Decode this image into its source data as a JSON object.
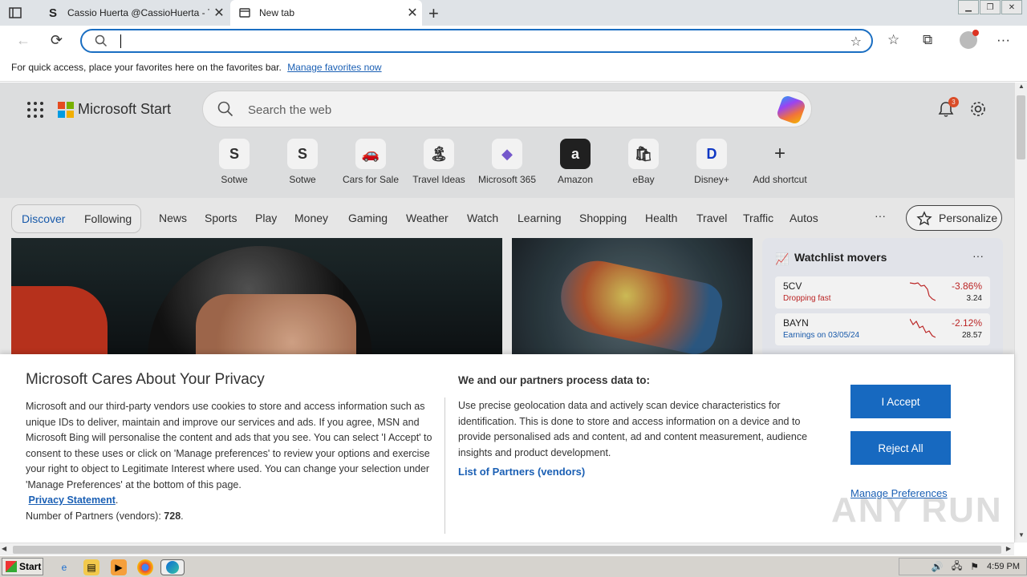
{
  "browser": {
    "tabs": [
      {
        "title": "Cassio Huerta @CassioHuerta - T",
        "favicon": "S",
        "active": false
      },
      {
        "title": "New tab",
        "favicon": "newtab-icon",
        "active": true
      }
    ],
    "favbar_text": "For quick access, place your favorites here on the favorites bar.",
    "favbar_link": "Manage favorites now"
  },
  "msstart": {
    "brand": "Microsoft Start",
    "search_placeholder": "Search the web",
    "notif_count": "3",
    "shortcuts": [
      {
        "label": "Sotwe",
        "glyph": "S"
      },
      {
        "label": "Sotwe",
        "glyph": "S"
      },
      {
        "label": "Cars for Sale",
        "glyph": "🚗"
      },
      {
        "label": "Travel Ideas",
        "glyph": "🏝"
      },
      {
        "label": "Microsoft 365",
        "glyph": "◆"
      },
      {
        "label": "Amazon",
        "glyph": "a"
      },
      {
        "label": "eBay",
        "glyph": "🛍"
      },
      {
        "label": "Disney+",
        "glyph": "D"
      },
      {
        "label": "Add shortcut",
        "glyph": "+"
      }
    ],
    "discover": "Discover",
    "following": "Following",
    "categories": [
      "News",
      "Sports",
      "Play",
      "Money",
      "Gaming",
      "Weather",
      "Watch",
      "Learning",
      "Shopping",
      "Health",
      "Travel",
      "Traffic",
      "Autos"
    ],
    "more": "···",
    "personalize": "Personalize",
    "watchlist": {
      "title": "Watchlist movers",
      "stocks": [
        {
          "symbol": "5CV",
          "sub": "Dropping fast",
          "pct": "-3.86%",
          "price": "3.24"
        },
        {
          "symbol": "BAYN",
          "sub": "Earnings on 03/05/24",
          "pct": "-2.12%",
          "price": "28.57"
        }
      ]
    }
  },
  "privacy": {
    "title": "Microsoft Cares About Your Privacy",
    "body": "Microsoft and our third-party vendors use cookies to store and access information such as unique IDs to deliver, maintain and improve our services and ads. If you agree, MSN and Microsoft Bing will personalise the content and ads that you see. You can select 'I Accept' to consent to these uses or click on 'Manage preferences' to review your options and exercise your right to object to Legitimate Interest where used.  You can change your selection under 'Manage Preferences' at the bottom of this page.",
    "privacy_link": "Privacy Statement",
    "partners_label": "Number of Partners (vendors):",
    "partners_count": "728",
    "h2": "We and our partners process data to:",
    "body2": "Use precise geolocation data and actively scan device characteristics for identification. This is done to store and access information on a device and to provide personalised ads and content, ad and content measurement, audience insights and product development.",
    "partners_link": "List of Partners (vendors)",
    "accept": "I Accept",
    "reject": "Reject All",
    "manage": "Manage Preferences"
  },
  "watermark": "ANY RUN",
  "taskbar": {
    "start": "Start",
    "clock": "4:59 PM"
  },
  "colors": {
    "accent": "#1769c0",
    "link": "#1a5fb4",
    "loss": "#c62828"
  }
}
